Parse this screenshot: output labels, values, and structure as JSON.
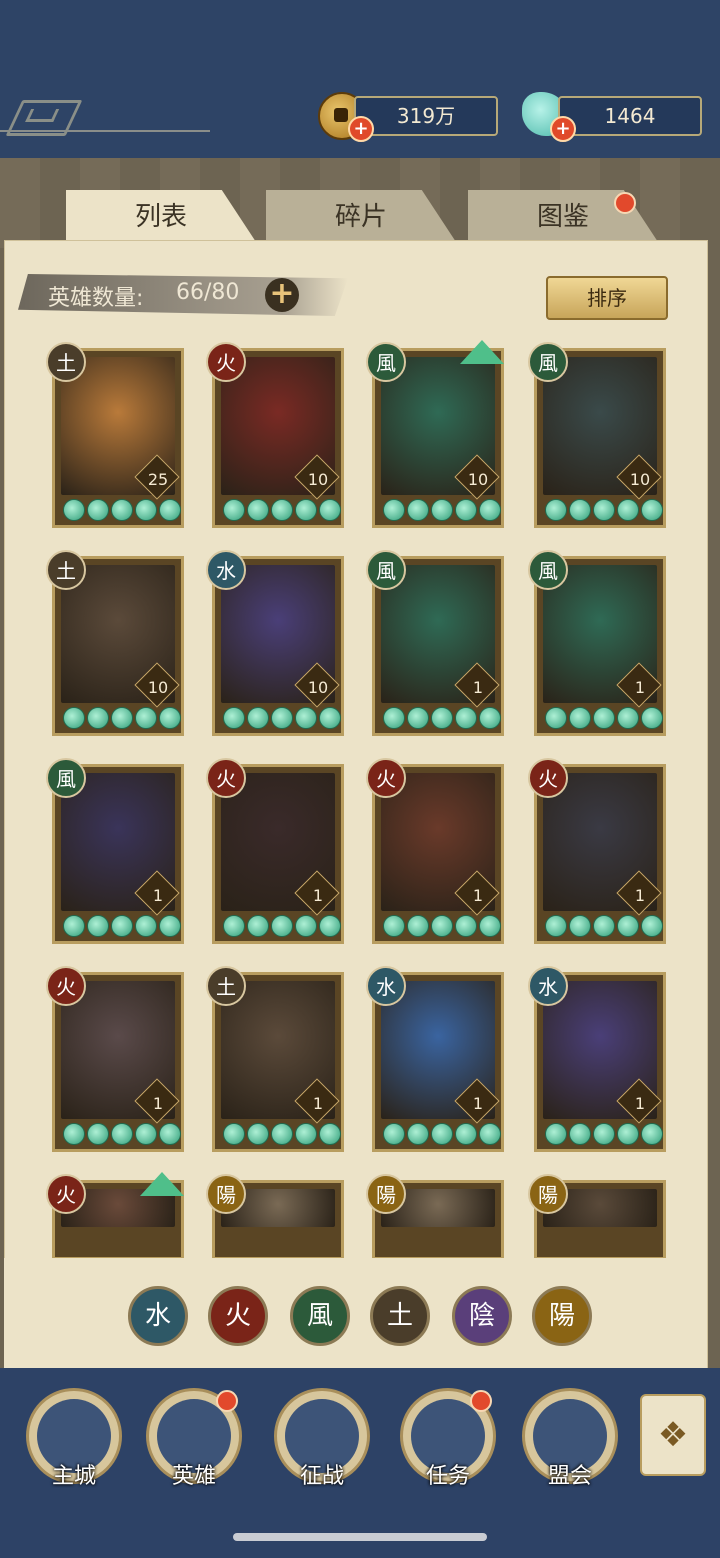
{
  "currency": {
    "coins": "319万",
    "jade": "1464"
  },
  "tabs": [
    {
      "label": "列表",
      "active": true
    },
    {
      "label": "碎片",
      "active": false
    },
    {
      "label": "图鉴",
      "active": false,
      "has_notification": true
    }
  ],
  "hero_count": {
    "label": "英雄数量:",
    "value": "66/80"
  },
  "sort_label": "排序",
  "element_glyphs": {
    "water": "水",
    "fire": "火",
    "wind": "風",
    "earth": "土",
    "yin": "陰",
    "yang": "陽"
  },
  "heroes": [
    {
      "element": "earth",
      "level": "25"
    },
    {
      "element": "fire",
      "level": "10"
    },
    {
      "element": "wind",
      "level": "10",
      "upgradable": true
    },
    {
      "element": "wind",
      "level": "10"
    },
    {
      "element": "earth",
      "level": "10"
    },
    {
      "element": "water",
      "level": "10"
    },
    {
      "element": "wind",
      "level": "1"
    },
    {
      "element": "wind",
      "level": "1"
    },
    {
      "element": "wind",
      "level": "1"
    },
    {
      "element": "fire",
      "level": "1"
    },
    {
      "element": "fire",
      "level": "1"
    },
    {
      "element": "fire",
      "level": "1"
    },
    {
      "element": "fire",
      "level": "1"
    },
    {
      "element": "earth",
      "level": "1"
    },
    {
      "element": "water",
      "level": "1"
    },
    {
      "element": "water",
      "level": "1"
    },
    {
      "element": "fire",
      "level": "",
      "upgradable": true
    },
    {
      "element": "yang",
      "level": ""
    },
    {
      "element": "yang",
      "level": ""
    },
    {
      "element": "yang",
      "level": ""
    }
  ],
  "element_colors": {
    "water": "#2e5866",
    "fire": "#7a2418",
    "wind": "#2c5a3a",
    "earth": "#4a3d2a",
    "yin": "#5a3f7a",
    "yang": "#8a6414"
  },
  "filters": [
    "water",
    "fire",
    "wind",
    "earth",
    "yin",
    "yang"
  ],
  "nav": [
    {
      "label": "主城",
      "notification": false
    },
    {
      "label": "英雄",
      "notification": true
    },
    {
      "label": "征战",
      "notification": false
    },
    {
      "label": "任务",
      "notification": true
    },
    {
      "label": "盟会",
      "notification": false
    }
  ]
}
